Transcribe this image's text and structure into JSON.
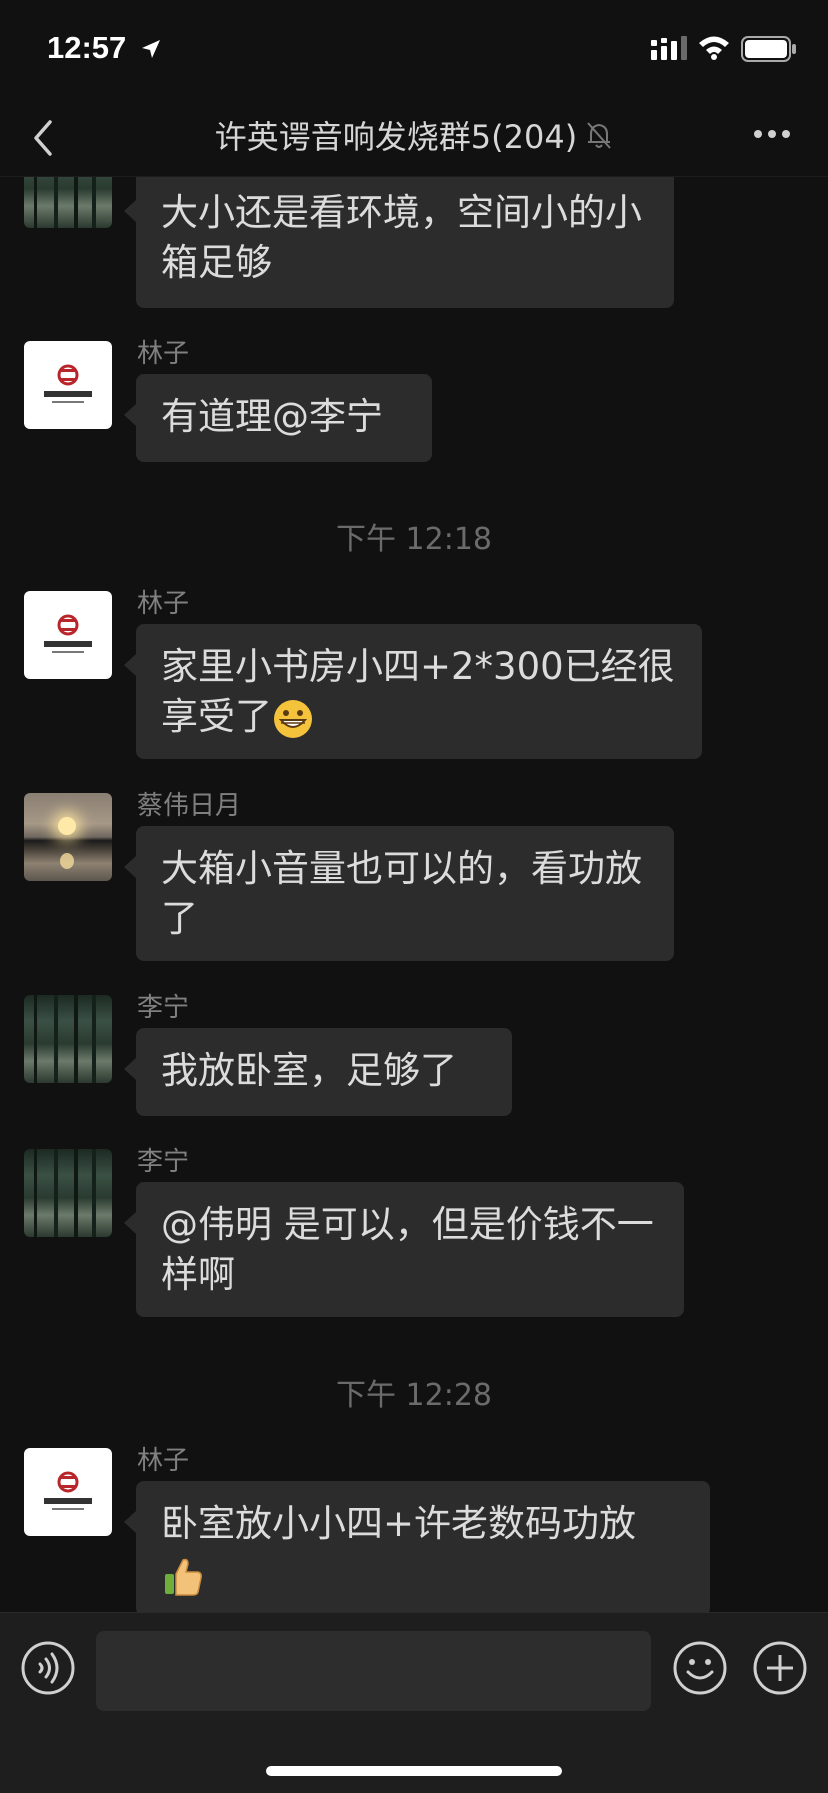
{
  "status_bar": {
    "time": "12:57"
  },
  "header": {
    "title": "许英谔音响发烧群5(204)"
  },
  "messages": [
    {
      "sender": "",
      "text": "大小还是看环境，空间小的小箱足够"
    },
    {
      "sender": "林子",
      "text": "有道理@李宁"
    },
    {
      "timestamp": "下午 12:18"
    },
    {
      "sender": "林子",
      "text": "家里小书房小四+2*300已经很享受了"
    },
    {
      "sender": "蔡伟日月",
      "text": "大箱小音量也可以的，看功放了"
    },
    {
      "sender": "李宁",
      "text": "我放卧室，足够了"
    },
    {
      "sender": "李宁",
      "text": "@伟明 是可以，但是价钱不一样啊"
    },
    {
      "timestamp": "下午 12:28"
    },
    {
      "sender": "林子",
      "text": "卧室放小小四+许老数码功放"
    }
  ],
  "icons": {
    "back": "chevron-left-icon",
    "mute": "bell-slash-icon",
    "more": "more-icon",
    "voice": "voice-icon",
    "emoji": "emoji-icon",
    "plus": "plus-icon",
    "grin": "grinning-face-icon",
    "thumbs": "thumbs-up-icon"
  },
  "colors": {
    "background": "#111111",
    "bubble": "#2c2c2c",
    "text": "#dcdcdc",
    "meta": "#808080"
  }
}
